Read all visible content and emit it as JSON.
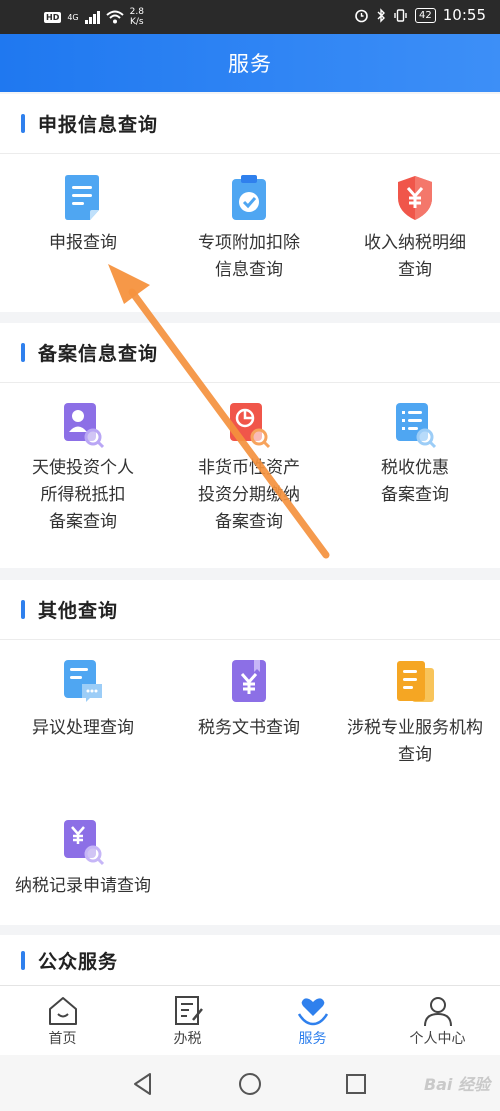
{
  "status_bar": {
    "hd": "HD",
    "network": "4G",
    "speed_value": "2.8",
    "speed_unit": "K/s",
    "battery": "42",
    "time": "10:55"
  },
  "header": {
    "title": "服务"
  },
  "sections": {
    "declaration": {
      "title": "申报信息查询",
      "items": [
        {
          "label": "申报查询",
          "icon": "document-icon"
        },
        {
          "label": "专项附加扣除\n信息查询",
          "icon": "clipboard-check-icon"
        },
        {
          "label": "收入纳税明细\n查询",
          "icon": "shield-yen-icon"
        }
      ]
    },
    "filing": {
      "title": "备案信息查询",
      "items": [
        {
          "label": "天使投资个人\n所得税抵扣\n备案查询",
          "icon": "person-search-icon"
        },
        {
          "label": "非货币性资产\n投资分期缴纳\n备案查询",
          "icon": "pie-chart-search-icon"
        },
        {
          "label": "税收优惠\n备案查询",
          "icon": "list-search-icon"
        }
      ]
    },
    "other": {
      "title": "其他查询",
      "items": [
        {
          "label": "异议处理查询",
          "icon": "message-doc-icon"
        },
        {
          "label": "税务文书查询",
          "icon": "yen-book-icon"
        },
        {
          "label": "涉税专业服务机构\n查询",
          "icon": "documents-icon"
        },
        {
          "label": "纳税记录申请查询",
          "icon": "yen-search-icon"
        }
      ]
    },
    "public": {
      "title": "公众服务"
    }
  },
  "tabbar": {
    "tabs": [
      {
        "label": "首页",
        "icon": "home-icon"
      },
      {
        "label": "办税",
        "icon": "edit-doc-icon"
      },
      {
        "label": "服务",
        "icon": "heart-hand-icon",
        "active": true
      },
      {
        "label": "个人中心",
        "icon": "user-icon"
      }
    ]
  },
  "watermark": "Bai 经验",
  "colors": {
    "accent": "#2f80ed",
    "header": "#1f78f0",
    "arrow": "#f5923e"
  }
}
